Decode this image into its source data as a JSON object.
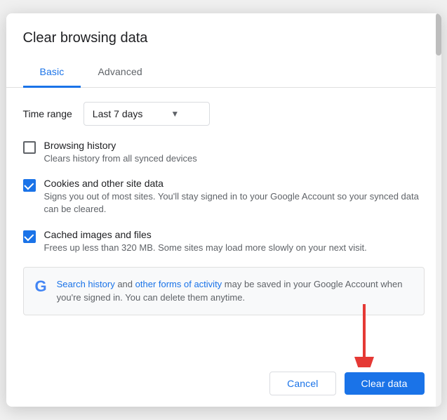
{
  "dialog": {
    "title": "Clear browsing data"
  },
  "tabs": [
    {
      "id": "basic",
      "label": "Basic",
      "active": true
    },
    {
      "id": "advanced",
      "label": "Advanced",
      "active": false
    }
  ],
  "time_range": {
    "label": "Time range",
    "selected": "Last 7 days"
  },
  "checkboxes": [
    {
      "id": "browsing-history",
      "label": "Browsing history",
      "description": "Clears history from all synced devices",
      "checked": false
    },
    {
      "id": "cookies",
      "label": "Cookies and other site data",
      "description": "Signs you out of most sites. You'll stay signed in to your Google Account so your synced data can be cleared.",
      "checked": true
    },
    {
      "id": "cached",
      "label": "Cached images and files",
      "description": "Frees up less than 320 MB. Some sites may load more slowly on your next visit.",
      "checked": true
    }
  ],
  "info_box": {
    "google_letter": "G",
    "text_part1": "Search history",
    "text_mid1": " and ",
    "text_link2": "other forms of activity",
    "text_part2": " may be saved in your Google Account when you're signed in. You can delete them anytime."
  },
  "footer": {
    "cancel_label": "Cancel",
    "clear_label": "Clear data"
  }
}
